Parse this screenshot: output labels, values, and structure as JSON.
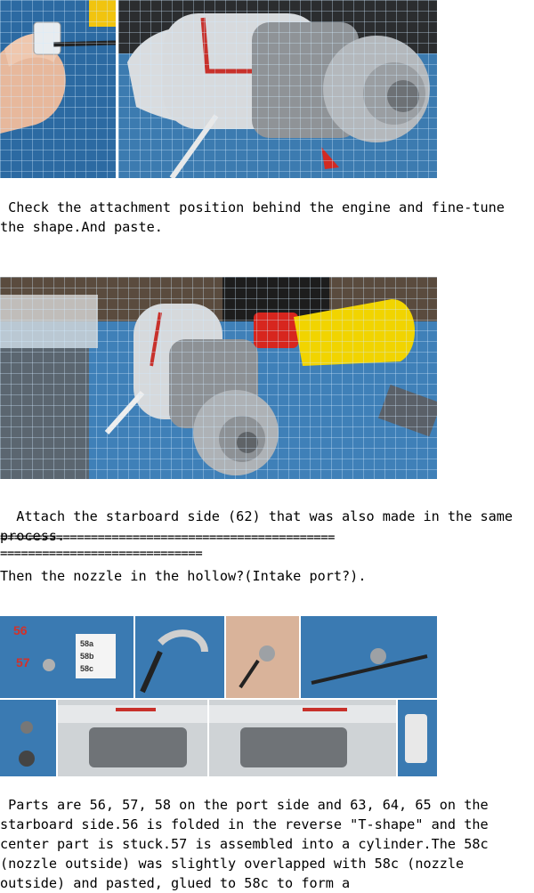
{
  "paragraphs": {
    "p1": " Check the attachment position behind the engine and fine-tune the shape.And paste.",
    "p2": "  Attach the starboard side (62) that was also made in the same process.",
    "sep1": "================================================",
    "sep2": "=============================",
    "p3": "Then the nozzle in the hollow?(Intake port?).",
    "p4": " Parts are 56, 57, 58 on the port side and 63, 64, 65 on the starboard side.56 is folded in the reverse \"T-shape\" and the center part is stuck.57 is assembled into a cylinder.The 58c (nozzle outside) was slightly overlapped with 58c (nozzle outside) and pasted, glued to 58c to form a"
  },
  "photo_labels": {
    "part_56": "56",
    "part_57": "57",
    "part_58a": "58a",
    "part_58b": "58b",
    "part_58c": "58c"
  },
  "colors": {
    "mat_blue": "#2f6da3",
    "model_grey": "#cfd3d6",
    "accent_red": "#c8312b",
    "glue_yellow": "#f1d400"
  }
}
